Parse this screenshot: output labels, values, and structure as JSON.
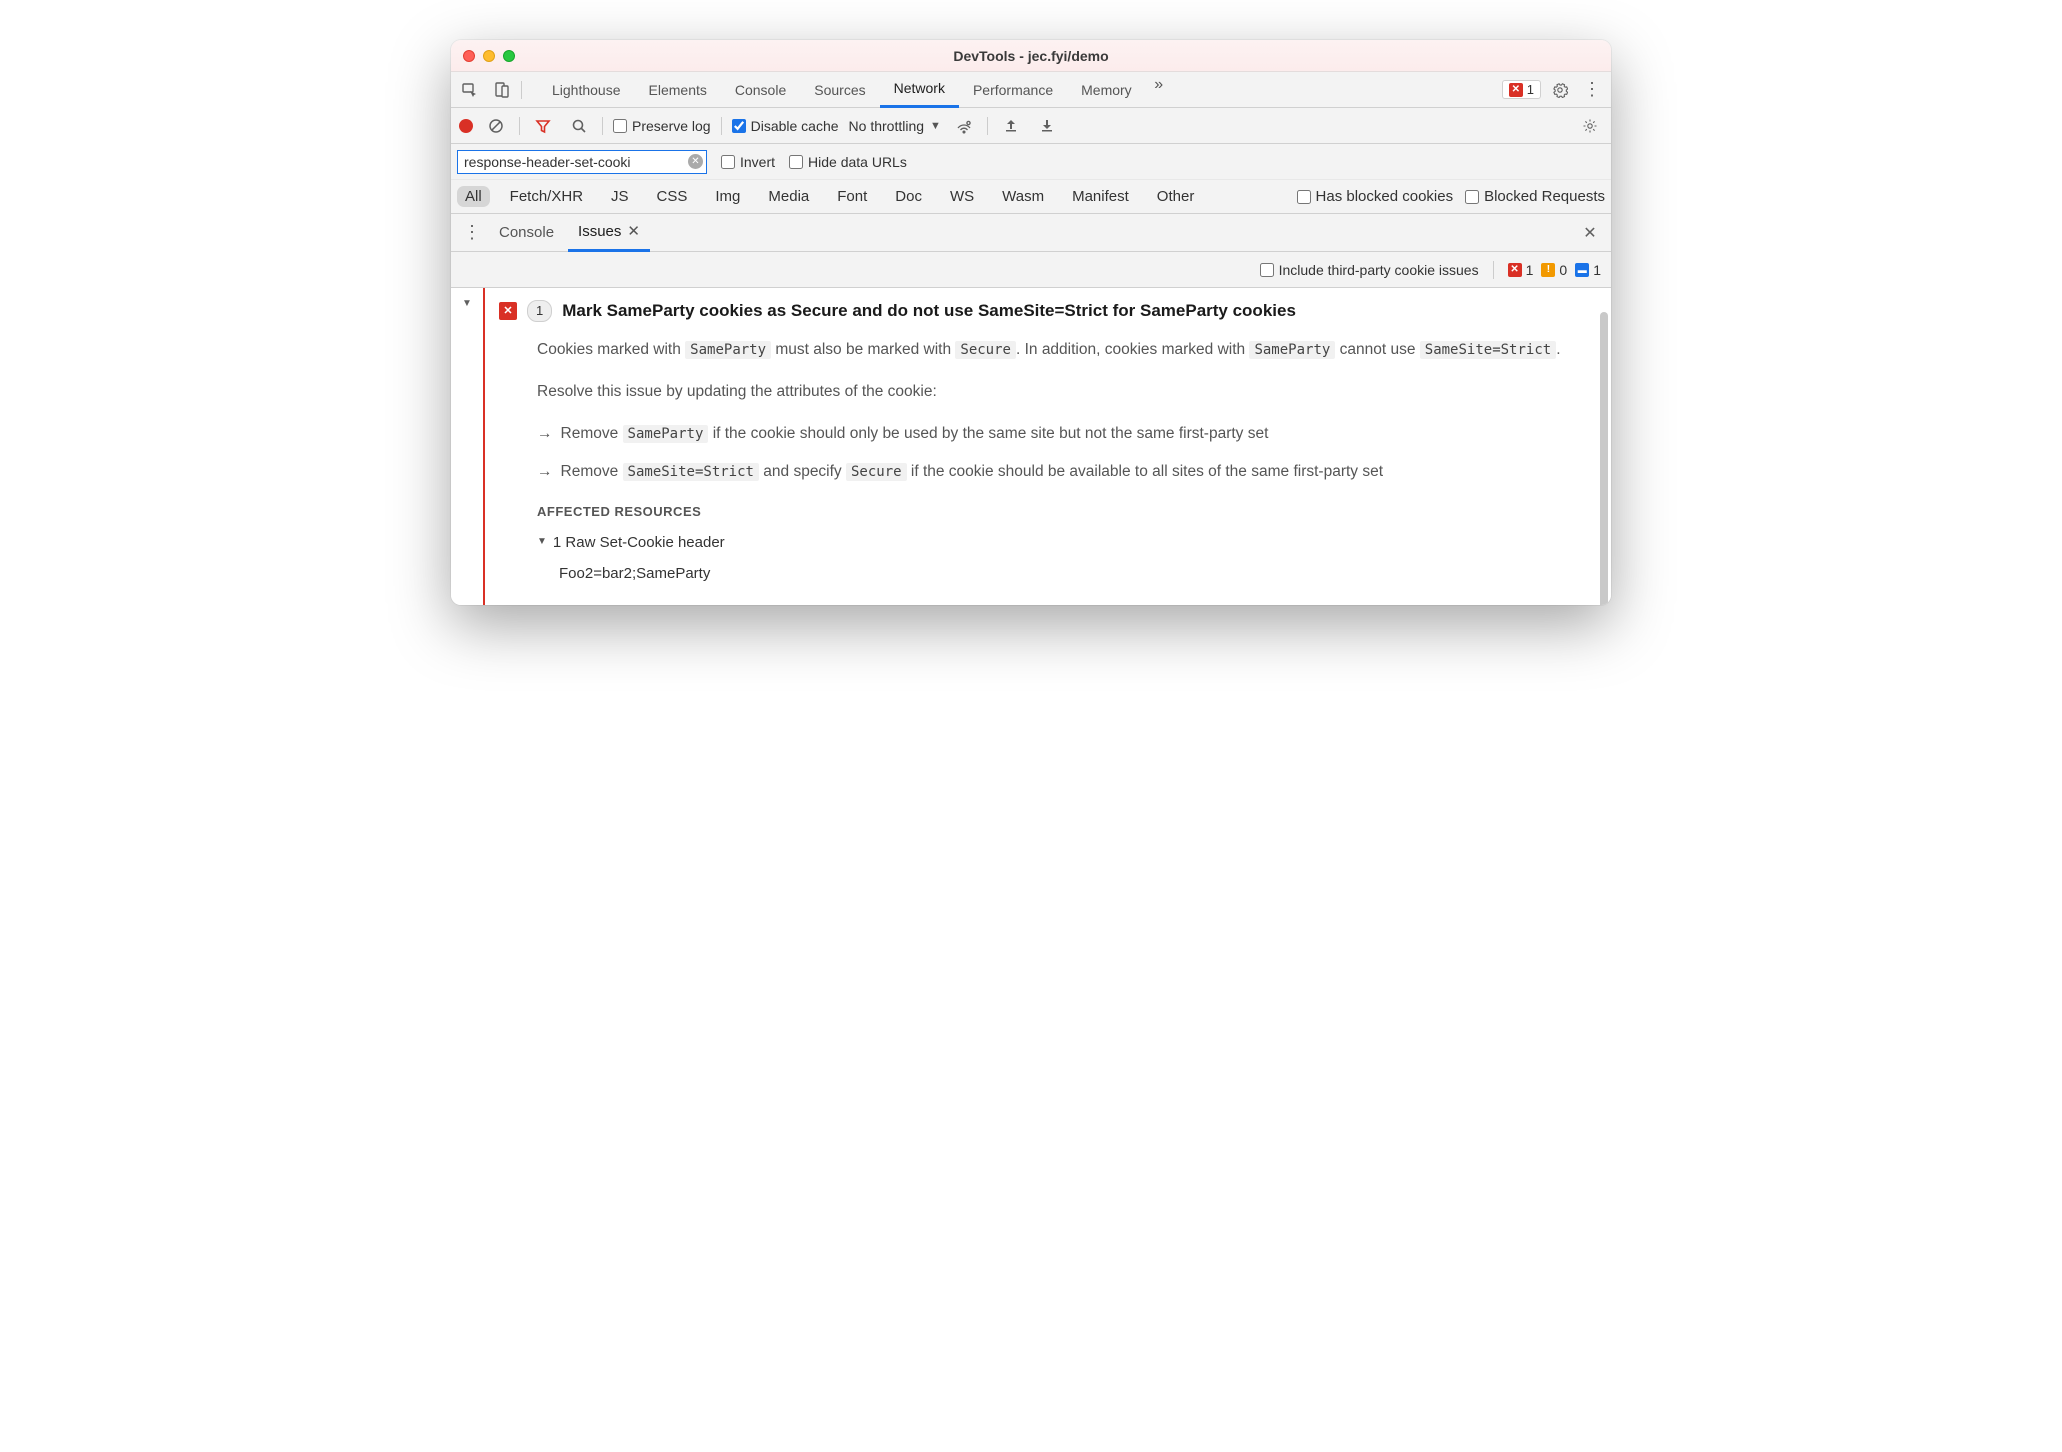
{
  "window": {
    "title": "DevTools - jec.fyi/demo"
  },
  "mainTabs": {
    "items": [
      "Lighthouse",
      "Elements",
      "Console",
      "Sources",
      "Network",
      "Performance",
      "Memory"
    ],
    "active": "Network",
    "errorCount": "1"
  },
  "networkToolbar": {
    "preserveLog": "Preserve log",
    "disableCache": "Disable cache",
    "throttling": "No throttling"
  },
  "filterRow": {
    "value": "response-header-set-cooki",
    "invert": "Invert",
    "hideDataUrls": "Hide data URLs"
  },
  "typeRow": {
    "types": [
      "All",
      "Fetch/XHR",
      "JS",
      "CSS",
      "Img",
      "Media",
      "Font",
      "Doc",
      "WS",
      "Wasm",
      "Manifest",
      "Other"
    ],
    "active": "All",
    "hasBlockedCookies": "Has blocked cookies",
    "blockedRequests": "Blocked Requests"
  },
  "drawer": {
    "tabs": [
      "Console",
      "Issues"
    ],
    "active": "Issues"
  },
  "issuesBar": {
    "includeThirdParty": "Include third-party cookie issues",
    "red": "1",
    "orange": "0",
    "blue": "1"
  },
  "issue": {
    "count": "1",
    "title": "Mark SameParty cookies as Secure and do not use SameSite=Strict for SameParty cookies",
    "desc1_a": "Cookies marked with ",
    "desc1_b": " must also be marked with ",
    "desc1_c": ". In addition, cookies marked with ",
    "desc1_d": " cannot use ",
    "desc1_e": ".",
    "code_sameparty": "SameParty",
    "code_secure": "Secure",
    "code_samesite": "SameSite=Strict",
    "desc2": "Resolve this issue by updating the attributes of the cookie:",
    "bullet1_a": "Remove ",
    "bullet1_b": " if the cookie should only be used by the same site but not the same first-party set",
    "bullet2_a": "Remove ",
    "bullet2_b": " and specify ",
    "bullet2_c": " if the cookie should be available to all sites of the same first-party set",
    "affectedLabel": "AFFECTED RESOURCES",
    "affectedHeader": "1 Raw Set-Cookie header",
    "affectedDetail": "Foo2=bar2;SameParty"
  }
}
